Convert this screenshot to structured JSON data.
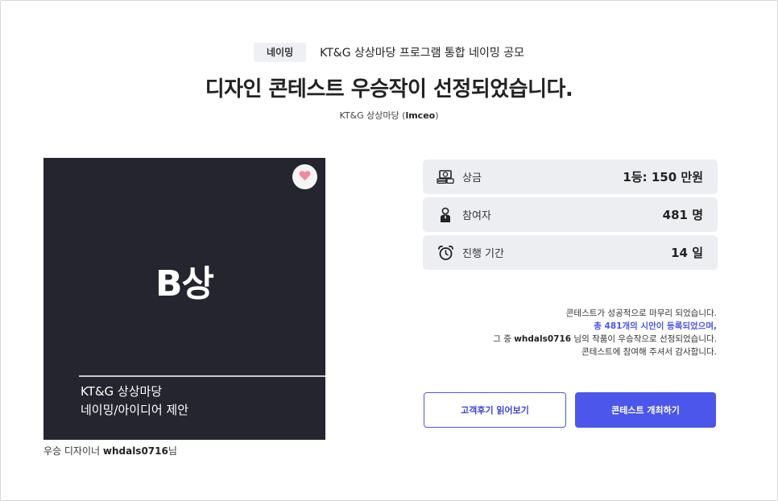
{
  "header": {
    "category": "네이밍",
    "contest_name": "KT&G 상상마당 프로그램 통합 네이밍 공모",
    "title": "디자인 콘테스트 우승작이 선정되었습니다.",
    "client_prefix": "KT&G 상상마당 (",
    "client_id": "lmceo",
    "client_suffix": ")"
  },
  "artwork": {
    "big_text": "B상",
    "line1": "KT&G 상상마당",
    "line2": "네이밍/아이디어 제안",
    "like_icon": "heart-icon"
  },
  "winner": {
    "prefix": "우승 디자이너 ",
    "name": "whdals0716",
    "suffix": "님"
  },
  "stats": [
    {
      "icon": "prize-money-icon",
      "label": "상금",
      "value": "1등: 150 만원"
    },
    {
      "icon": "participant-icon",
      "label": "참여자",
      "value": "481 명"
    },
    {
      "icon": "alarm-clock-icon",
      "label": "진행 기간",
      "value": "14 일"
    }
  ],
  "message": {
    "line1": "콘테스트가 성공적으로 마무리 되었습니다.",
    "line2": "총 481개의 시안이 등록되었으며,",
    "line3_prefix": "그 중 ",
    "line3_name": "whdals0716",
    "line3_suffix": " 님의 작품이 우승작으로 선정되었습니다.",
    "line4": "콘테스트에 참여해 주셔서 감사합니다."
  },
  "buttons": {
    "reviews": "고객후기 읽어보기",
    "host": "콘테스트 개최하기"
  },
  "colors": {
    "accent": "#4c56ea",
    "artwork_bg": "#25252f",
    "card_bg": "#eceef1",
    "heart": "#f08aa0"
  }
}
